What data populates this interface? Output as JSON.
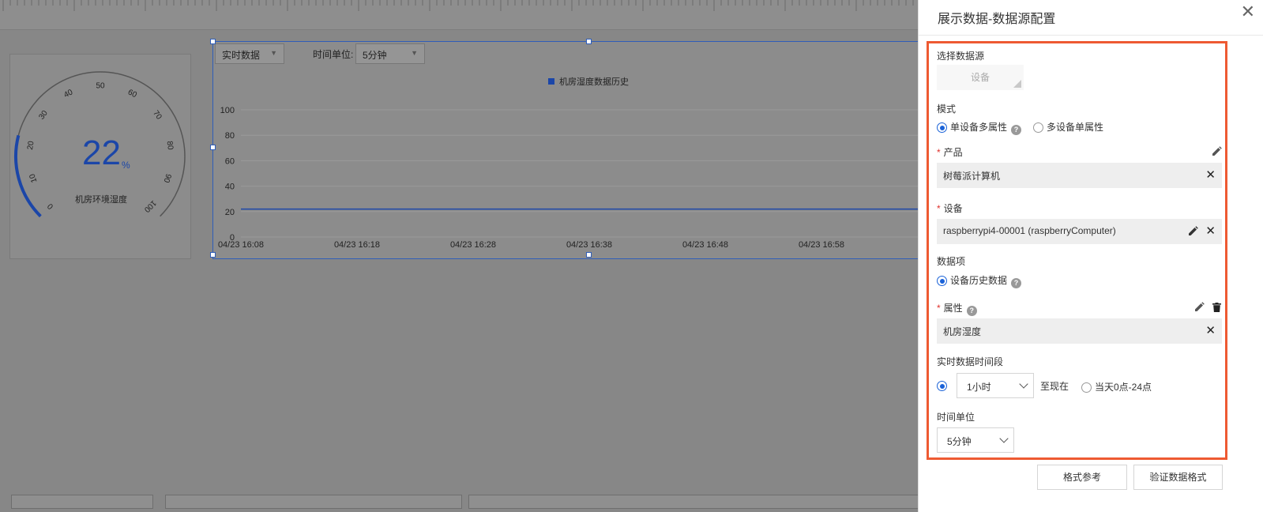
{
  "canvas": {
    "gauge": {
      "value": "22",
      "unit": "%",
      "label": "机房环境湿度",
      "ticks": [
        "0",
        "10",
        "20",
        "30",
        "40",
        "50",
        "60",
        "70",
        "80",
        "90",
        "100"
      ],
      "level": 0.22
    },
    "chart": {
      "mode_dropdown": "实时数据",
      "time_unit_label": "时间单位:",
      "time_unit_dropdown": "5分钟",
      "legend": "机房湿度数据历史"
    }
  },
  "chart_data": {
    "type": "line",
    "title": "",
    "xlabel": "",
    "ylabel": "",
    "x": [
      "04/23 16:08",
      "04/23 16:18",
      "04/23 16:28",
      "04/23 16:38",
      "04/23 16:48",
      "04/23 16:58"
    ],
    "series": [
      {
        "name": "机房湿度数据历史",
        "values": [
          22,
          22,
          22,
          22,
          22,
          22
        ]
      }
    ],
    "yticks": [
      "0",
      "20",
      "40",
      "60",
      "80",
      "100"
    ],
    "ylim": [
      0,
      100
    ],
    "grid": true,
    "legend_position": "top-center",
    "color": "#1b46a8"
  },
  "panel": {
    "title": "展示数据-数据源配置",
    "source_label": "选择数据源",
    "source_button": "设备",
    "mode_label": "模式",
    "mode_options": [
      "单设备多属性",
      "多设备单属性"
    ],
    "product_label": "产品",
    "product_value": "树莓派计算机",
    "device_label": "设备",
    "device_value": "raspberrypi4-00001 (raspberryComputer)",
    "data_item_label": "数据项",
    "data_item_option": "设备历史数据",
    "property_label": "属性",
    "property_value": "机房湿度",
    "period_label": "实时数据时间段",
    "period_select": "1小时",
    "period_to_now": "至现在",
    "period_alt": "当天0点-24点",
    "time_unit_label": "时间单位",
    "time_unit_select": "5分钟",
    "btn_format_ref": "格式参考",
    "btn_validate": "验证数据格式",
    "help_glyph": "?",
    "close_glyph": "✕",
    "required_mark": "*"
  },
  "colors": {
    "accent": "#1a62d8",
    "highlight_border": "#ee5a32",
    "chart_line": "#1b46a8"
  }
}
